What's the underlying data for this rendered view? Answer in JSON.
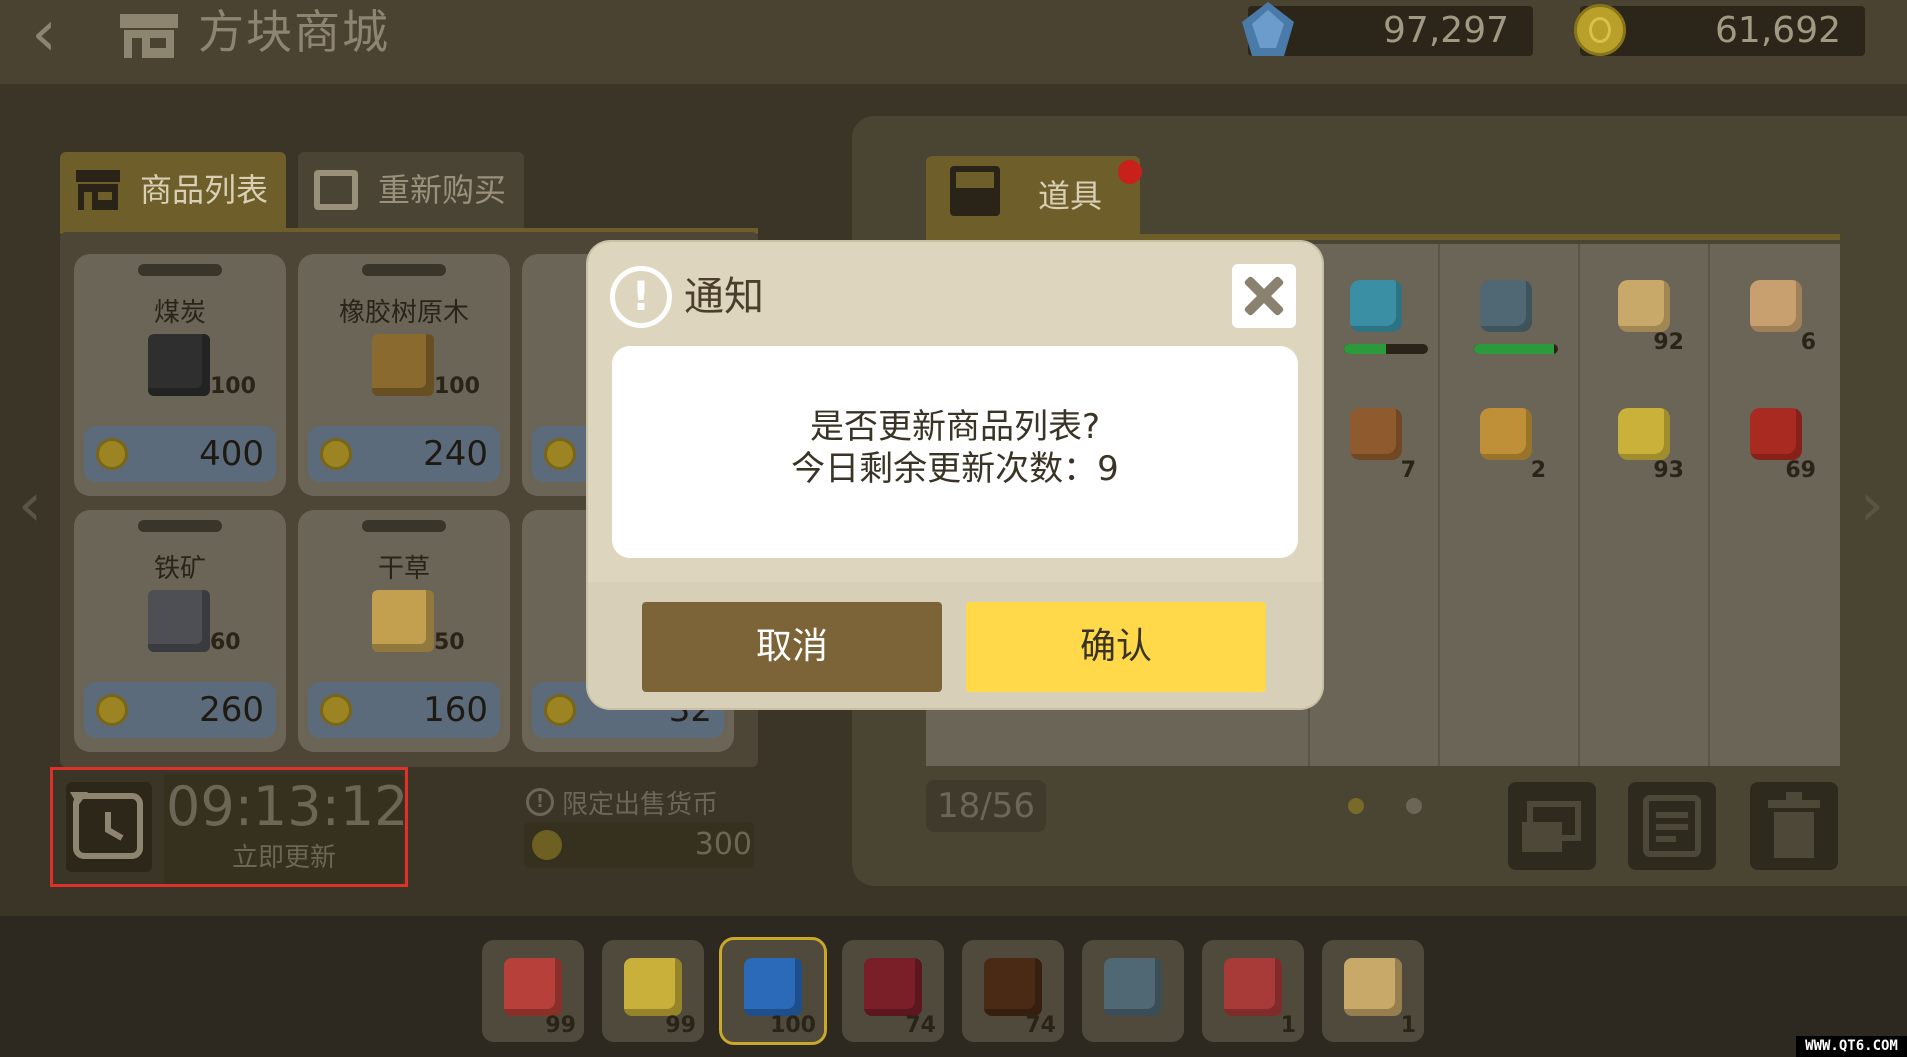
{
  "header": {
    "back_label": "‹",
    "title": "方块商城",
    "gems": "97,297",
    "coins": "61,692"
  },
  "left_tabs": [
    {
      "label": "商品列表",
      "active": true
    },
    {
      "label": "重新购买",
      "active": false
    }
  ],
  "goods": [
    {
      "name": "煤炭",
      "count": "100",
      "price": "400",
      "icon": "coal-block-icon",
      "color": "#2f2f2f"
    },
    {
      "name": "橡胶树原木",
      "count": "100",
      "price": "240",
      "icon": "log-block-icon",
      "color": "#8a6a2e"
    },
    {
      "name": "",
      "count": "",
      "price": "",
      "icon": "hidden-item-icon",
      "color": "#6a6556"
    },
    {
      "name": "铁矿",
      "count": "60",
      "price": "260",
      "icon": "iron-ore-icon",
      "color": "#4d4f55"
    },
    {
      "name": "干草",
      "count": "50",
      "price": "160",
      "icon": "hay-icon",
      "color": "#c2a050"
    },
    {
      "name": "",
      "count": "",
      "price": "32",
      "icon": "hidden-item-icon",
      "color": "#6a6556"
    }
  ],
  "refresh": {
    "timer": "09:13:12",
    "button_label": "立即更新"
  },
  "limit": {
    "label": "限定出售货币",
    "price": "300"
  },
  "right_tab": {
    "label": "道具"
  },
  "inventory": {
    "items": [
      {
        "icon": "pickaxe-icon",
        "count": "",
        "color": "#3a8fa5",
        "bar": 0.5
      },
      {
        "icon": "hammer-icon",
        "count": "",
        "color": "#4f6873",
        "bar": 0.95
      },
      {
        "icon": "egg-icon",
        "count": "92",
        "color": "#c9a96a"
      },
      {
        "icon": "meat-icon",
        "count": "6",
        "color": "#c8a070"
      },
      {
        "icon": "roast-icon",
        "count": "7",
        "color": "#8f5a2e"
      },
      {
        "icon": "honey-jar-icon",
        "count": "2",
        "color": "#c09038"
      },
      {
        "icon": "cheese-icon",
        "count": "93",
        "color": "#c9b13a"
      },
      {
        "icon": "apple-icon",
        "count": "69",
        "color": "#a82a20"
      }
    ],
    "capacity": "18/56"
  },
  "hotbar": [
    {
      "icon": "red-block-icon",
      "count": "99",
      "color": "#b8403a"
    },
    {
      "icon": "yellow-block-icon",
      "count": "99",
      "color": "#c9b03a"
    },
    {
      "icon": "blue-block-icon",
      "count": "100",
      "color": "#2a6ab8"
    },
    {
      "icon": "crimson-block-icon",
      "count": "74",
      "color": "#7a1e28"
    },
    {
      "icon": "brown-block-icon",
      "count": "74",
      "color": "#4a2a14"
    },
    {
      "icon": "hammer-icon",
      "count": "",
      "color": "#4f6873"
    },
    {
      "icon": "potion-icon",
      "count": "1",
      "color": "#a83a38"
    },
    {
      "icon": "egg-icon",
      "count": "1",
      "color": "#c9a96a"
    }
  ],
  "dialog": {
    "title": "通知",
    "message_line1": "是否更新商品列表?",
    "message_line2": "今日剩余更新次数：9",
    "cancel_label": "取消",
    "confirm_label": "确认"
  },
  "watermark": "WWW.QT6.COM"
}
